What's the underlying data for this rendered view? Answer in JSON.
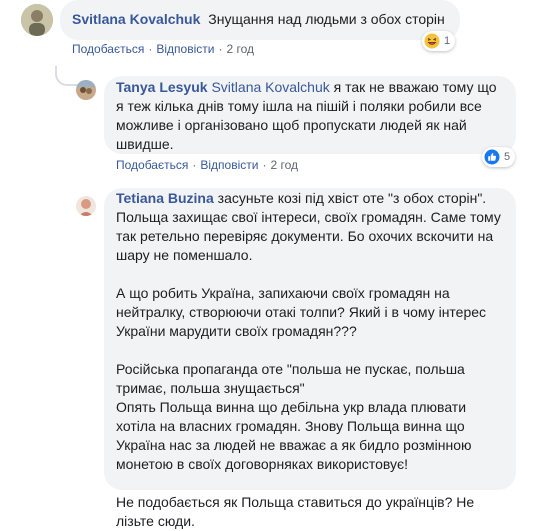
{
  "comments": [
    {
      "author": "Svitlana Kovalchuk",
      "text": "Знущання над людьми з обох сторін",
      "like_label": "Подобається",
      "reply_label": "Відповісти",
      "time": "2 год",
      "reaction": {
        "icon": "haha-reaction-icon",
        "count": "1"
      }
    },
    {
      "author": "Tanya Lesyuk",
      "mention": "Svitlana Kovalchuk",
      "text_lines": [
        " я так не вважаю тому що",
        "я теж кілька днів тому ішла на пішій і поляки робили все",
        "можливе і організовано щоб пропускати людей як най",
        "швидше."
      ],
      "like_label": "Подобається",
      "reply_label": "Відповісти",
      "time": "2 год",
      "reaction": {
        "icon": "like-reaction-icon",
        "count": "5"
      }
    },
    {
      "author": "Tetiana Buzina",
      "paragraphs": [
        [
          " засуньте козі під хвіст оте \"з обох сторін\".",
          "Польща захищає свої інтереси, своїх громадян. Саме тому",
          "так ретельно перевіряє документи. Бо охочих вскочити на",
          "шару не поменшало."
        ],
        [
          "А що робить Україна, запихаючи своїх громадян на",
          "нейтралку, створюючи отакі толпи? Який і в чому інтерес",
          "України марудити своїх громадян???"
        ],
        [
          "Російська пропаганда оте \"польша не пускає, польша",
          "тримає, польша знущається\"",
          "Опять Польща винна що дебільна укр влада плювати",
          "хотіла на власних громадян. Знову Польща винна що",
          "Україна нас за людей не вважає а як бидло розмінною",
          "монетою в своїх договорняках використовує!"
        ],
        [
          "Не подобається як Польща ставиться до українців? Не",
          "лізьте сюди."
        ]
      ]
    }
  ],
  "colors": {
    "link": "#385898",
    "bubble": "#f2f3f5",
    "meta": "#606770"
  }
}
